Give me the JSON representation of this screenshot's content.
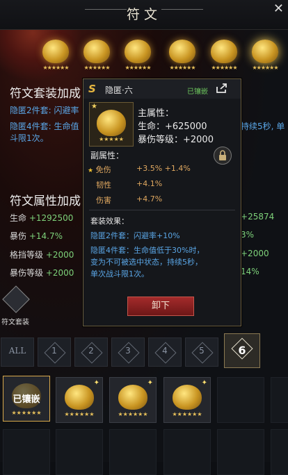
{
  "header": {
    "title": "符文",
    "close_icon": "x-icon"
  },
  "rune_slots": [
    {
      "stars": "★★★★★★",
      "selected": false
    },
    {
      "stars": "★★★★★★",
      "selected": false
    },
    {
      "stars": "★★★★★★",
      "selected": false
    },
    {
      "stars": "★★★★★★",
      "selected": false
    },
    {
      "stars": "★★★★★★",
      "selected": false
    },
    {
      "stars": "★★★★★★",
      "selected": true
    }
  ],
  "set_bonus": {
    "title": "符文套装加成",
    "line1_label": "隐匿2件套: 闪避率",
    "line2_label": "隐匿4件套: 生命值",
    "line2_right": "持续5秒, 单",
    "line3": "斗限1次。"
  },
  "attr_bonus": {
    "title": "符文属性加成",
    "rows": [
      {
        "label": "生命",
        "value": "+1292500",
        "right": "25874",
        "right_sign": "+"
      },
      {
        "label": "暴伤",
        "value": "+14.7%",
        "right": "3%",
        "right_sign": ""
      },
      {
        "label": "格挡等级",
        "value": "+2000",
        "right": "+2000",
        "right_sign": ""
      },
      {
        "label": "暴伤等级",
        "value": "+2000",
        "right": "14%",
        "right_sign": ""
      }
    ]
  },
  "tooltip": {
    "badge": "S",
    "name": "隐匿·六",
    "status": "已镶嵌",
    "main_title": "主属性：",
    "main_hp": "生命：+625000",
    "main_crit": "暴伤等级：+2000",
    "sub_title": "副属性：",
    "subs": [
      {
        "name": "免伤",
        "value": "+3.5% +1.4%",
        "starred": true
      },
      {
        "name": "韧性",
        "value": "+4.1%",
        "starred": false
      },
      {
        "name": "伤害",
        "value": "+4.7%",
        "starred": false
      }
    ],
    "set_title": "套装效果：",
    "set2": "隐匿2件套：闪避率+10%",
    "set4a": "隐匿4件套：生命值低于30%时，",
    "set4b": "变为不可被选中状态，持续5秒，",
    "set4c": "单次战斗限1次。",
    "unequip_label": "卸下",
    "icon_stars": "★★★★★"
  },
  "set_button": {
    "label": "符文套装"
  },
  "tabs": [
    {
      "label": "ALL",
      "selected": false
    },
    {
      "label": "1",
      "selected": false
    },
    {
      "label": "2",
      "selected": false
    },
    {
      "label": "3",
      "selected": false
    },
    {
      "label": "4",
      "selected": false
    },
    {
      "label": "5",
      "selected": false
    },
    {
      "label": "6",
      "selected": true
    }
  ],
  "inventory": [
    {
      "label": "已镶嵌",
      "stars": "★★★★★★",
      "selected": true
    },
    {
      "label": "",
      "stars": "★★★★★★",
      "selected": false
    },
    {
      "label": "",
      "stars": "★★★★★★",
      "selected": false
    },
    {
      "label": "",
      "stars": "★★★★★★",
      "selected": false
    }
  ],
  "colors": {
    "gold": "#e8c15b",
    "blue_text": "#5aa6e6",
    "green_value": "#7ed27a",
    "orange_sub": "#e0a860",
    "red_button": "#a32b2b"
  }
}
